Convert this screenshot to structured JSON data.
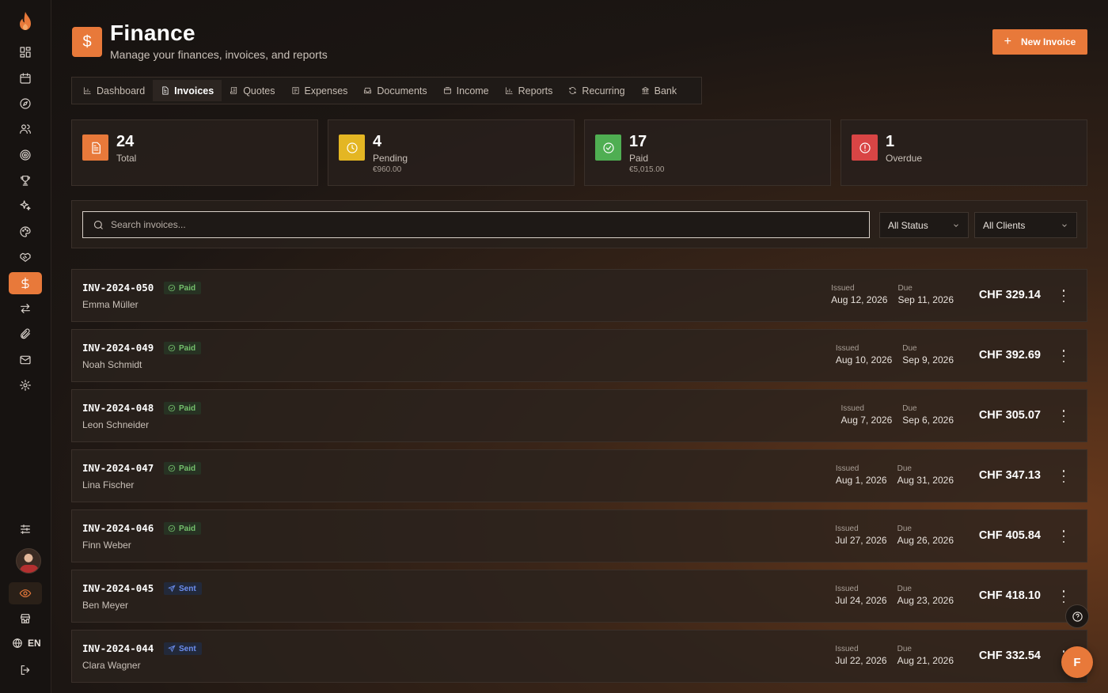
{
  "header": {
    "icon": "dollar-icon",
    "icon_glyph": "$",
    "title": "Finance",
    "subtitle": "Manage your finances, invoices, and reports",
    "new_invoice_label": "New Invoice"
  },
  "tabs": [
    {
      "label": "Dashboard",
      "icon": "bar-chart-icon",
      "active": false
    },
    {
      "label": "Invoices",
      "icon": "file-icon",
      "active": true
    },
    {
      "label": "Quotes",
      "icon": "scroll-icon",
      "active": false
    },
    {
      "label": "Expenses",
      "icon": "receipt-icon",
      "active": false
    },
    {
      "label": "Documents",
      "icon": "inbox-icon",
      "active": false
    },
    {
      "label": "Income",
      "icon": "wallet-icon",
      "active": false
    },
    {
      "label": "Reports",
      "icon": "bar-chart-icon",
      "active": false
    },
    {
      "label": "Recurring",
      "icon": "refresh-icon",
      "active": false
    },
    {
      "label": "Bank",
      "icon": "bank-icon",
      "active": false
    }
  ],
  "stats": {
    "total": {
      "value": "24",
      "label": "Total",
      "color": "#e8793a"
    },
    "pending": {
      "value": "4",
      "label": "Pending",
      "amount": "€960.00",
      "color": "#e4b623"
    },
    "paid": {
      "value": "17",
      "label": "Paid",
      "amount": "€5,015.00",
      "color": "#4fae52"
    },
    "overdue": {
      "value": "1",
      "label": "Overdue",
      "color": "#d94545"
    }
  },
  "filters": {
    "search_placeholder": "Search invoices...",
    "status_value": "All Status",
    "clients_value": "All Clients"
  },
  "invoices": [
    {
      "number": "INV-2024-050",
      "status": "Paid",
      "client": "Emma Müller",
      "issued_label": "Issued",
      "issued": "Aug 12, 2026",
      "due_label": "Due",
      "due": "Sep 11, 2026",
      "amount": "CHF 329.14"
    },
    {
      "number": "INV-2024-049",
      "status": "Paid",
      "client": "Noah Schmidt",
      "issued_label": "Issued",
      "issued": "Aug 10, 2026",
      "due_label": "Due",
      "due": "Sep 9, 2026",
      "amount": "CHF 392.69"
    },
    {
      "number": "INV-2024-048",
      "status": "Paid",
      "client": "Leon Schneider",
      "issued_label": "Issued",
      "issued": "Aug 7, 2026",
      "due_label": "Due",
      "due": "Sep 6, 2026",
      "amount": "CHF 305.07"
    },
    {
      "number": "INV-2024-047",
      "status": "Paid",
      "client": "Lina Fischer",
      "issued_label": "Issued",
      "issued": "Aug 1, 2026",
      "due_label": "Due",
      "due": "Aug 31, 2026",
      "amount": "CHF 347.13"
    },
    {
      "number": "INV-2024-046",
      "status": "Paid",
      "client": "Finn Weber",
      "issued_label": "Issued",
      "issued": "Jul 27, 2026",
      "due_label": "Due",
      "due": "Aug 26, 2026",
      "amount": "CHF 405.84"
    },
    {
      "number": "INV-2024-045",
      "status": "Sent",
      "client": "Ben Meyer",
      "issued_label": "Issued",
      "issued": "Jul 24, 2026",
      "due_label": "Due",
      "due": "Aug 23, 2026",
      "amount": "CHF 418.10"
    },
    {
      "number": "INV-2024-044",
      "status": "Sent",
      "client": "Clara Wagner",
      "issued_label": "Issued",
      "issued": "Jul 22, 2026",
      "due_label": "Due",
      "due": "Aug 21, 2026",
      "amount": "CHF 332.54"
    }
  ],
  "sidebar": {
    "language": "EN",
    "fab_letter": "F",
    "accent": "#e8793a"
  }
}
